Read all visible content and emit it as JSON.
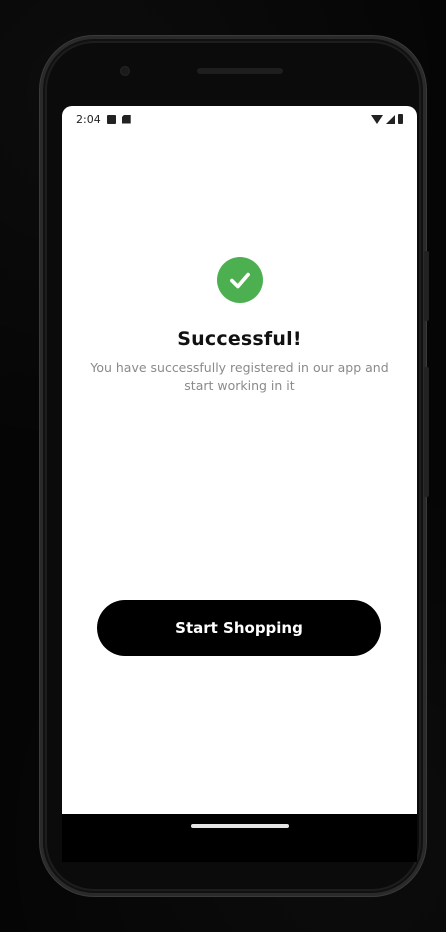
{
  "status_bar": {
    "time": "2:04"
  },
  "success": {
    "icon": "check-circle-icon",
    "icon_color": "#4caf50",
    "title": "Successful!",
    "message": "You have successfully registered in our app and start working in it"
  },
  "actions": {
    "primary_label": "Start Shopping",
    "primary_color": "#000000"
  }
}
